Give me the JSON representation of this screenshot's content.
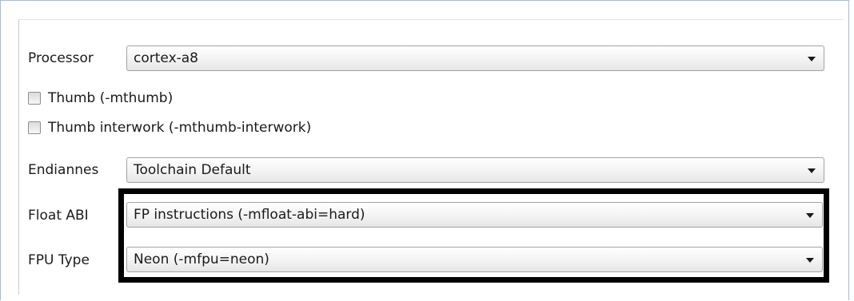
{
  "processor": {
    "label": "Processor",
    "value": "cortex-a8"
  },
  "options": [
    {
      "label": "Thumb (-mthumb)",
      "checked": false
    },
    {
      "label": "Thumb interwork (-mthumb-interwork)",
      "checked": false
    }
  ],
  "endianness": {
    "label": "Endiannes",
    "value": "Toolchain Default"
  },
  "float_abi": {
    "label": "Float ABI",
    "value": "FP instructions (-mfloat-abi=hard)"
  },
  "fpu_type": {
    "label": "FPU Type",
    "value": "Neon (-mfpu=neon)"
  }
}
